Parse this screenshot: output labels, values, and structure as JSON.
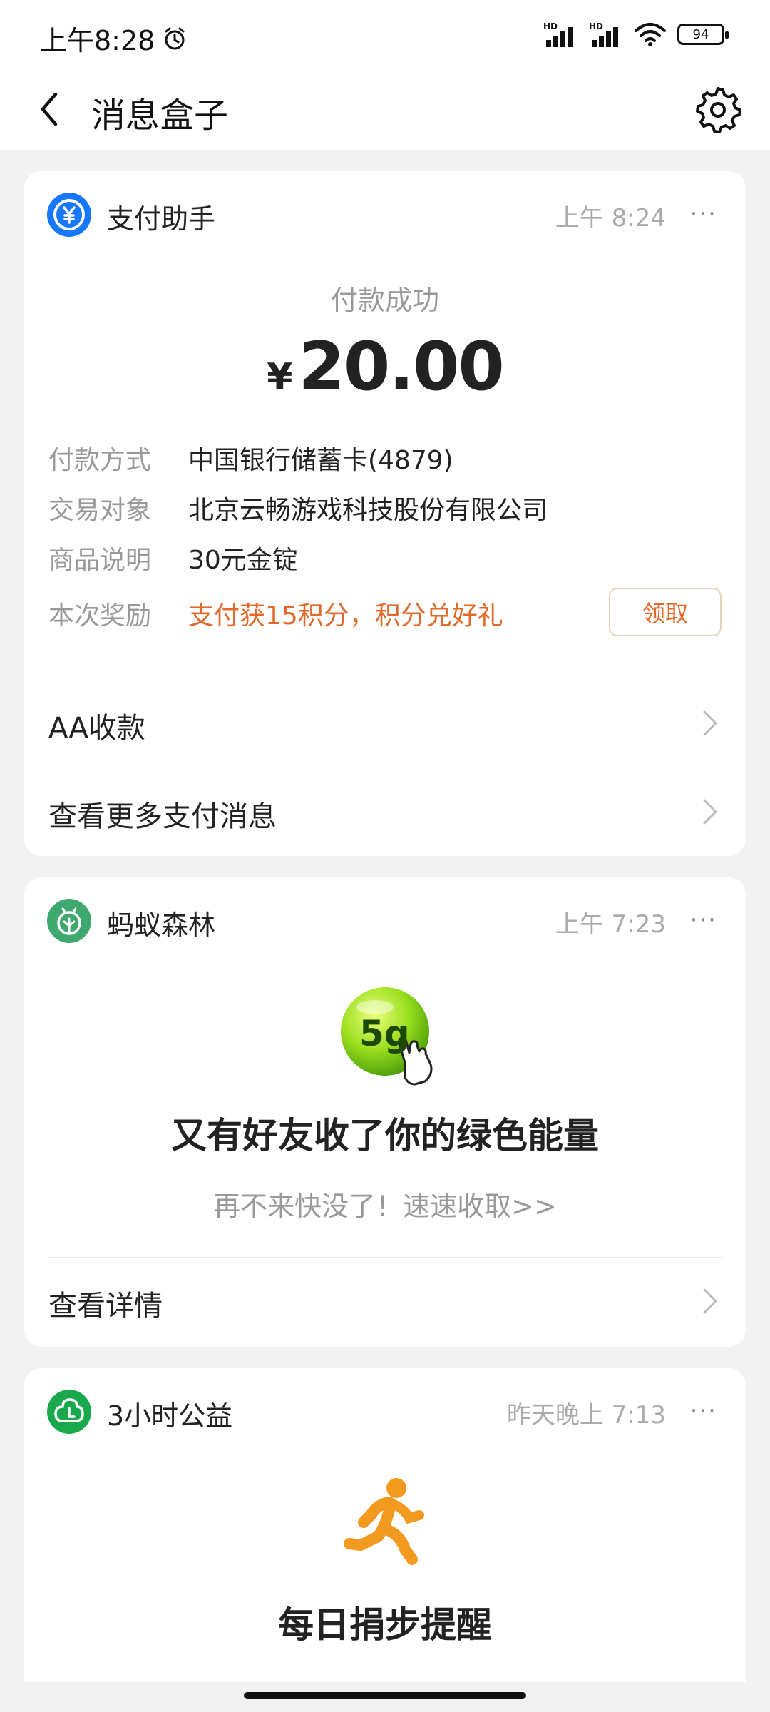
{
  "status_bar": {
    "time": "上午8:28",
    "signal_label": "HD",
    "battery": "94"
  },
  "navbar": {
    "title": "消息盒子"
  },
  "payment_card": {
    "app_name": "支付助手",
    "time": "上午 8:24",
    "more": "···",
    "status": "付款成功",
    "currency": "¥",
    "amount": "20.00",
    "details": [
      {
        "label": "付款方式",
        "value": "中国银行储蓄卡(4879)"
      },
      {
        "label": "交易对象",
        "value": "北京云畅游戏科技股份有限公司"
      },
      {
        "label": "商品说明",
        "value": "30元金锭"
      },
      {
        "label": "本次奖励",
        "value": "支付获15积分，积分兑好礼"
      }
    ],
    "claim_label": "领取",
    "links": [
      "AA收款",
      "查看更多支付消息"
    ]
  },
  "forest_card": {
    "app_name": "蚂蚁森林",
    "time": "上午 7:23",
    "more": "···",
    "energy_label": "5g",
    "title": "又有好友收了你的绿色能量",
    "subtitle": "再不来快没了！速速收取>>",
    "link": "查看详情"
  },
  "charity_card": {
    "app_name": "3小时公益",
    "time": "昨天晚上 7:13",
    "more": "···",
    "title": "每日捐步提醒"
  },
  "colors": {
    "alipay_blue": "#1677ff",
    "forest_green": "#3fa86e",
    "charity_green": "#19a84b",
    "reward_orange": "#e3692a"
  },
  "icons": [
    "clock-icon",
    "signal-icon",
    "wifi-icon",
    "battery-icon",
    "back-arrow-icon",
    "settings-gear-icon",
    "yen-icon",
    "forest-icon",
    "charity-icon",
    "chevron-right-icon",
    "runner-icon"
  ]
}
